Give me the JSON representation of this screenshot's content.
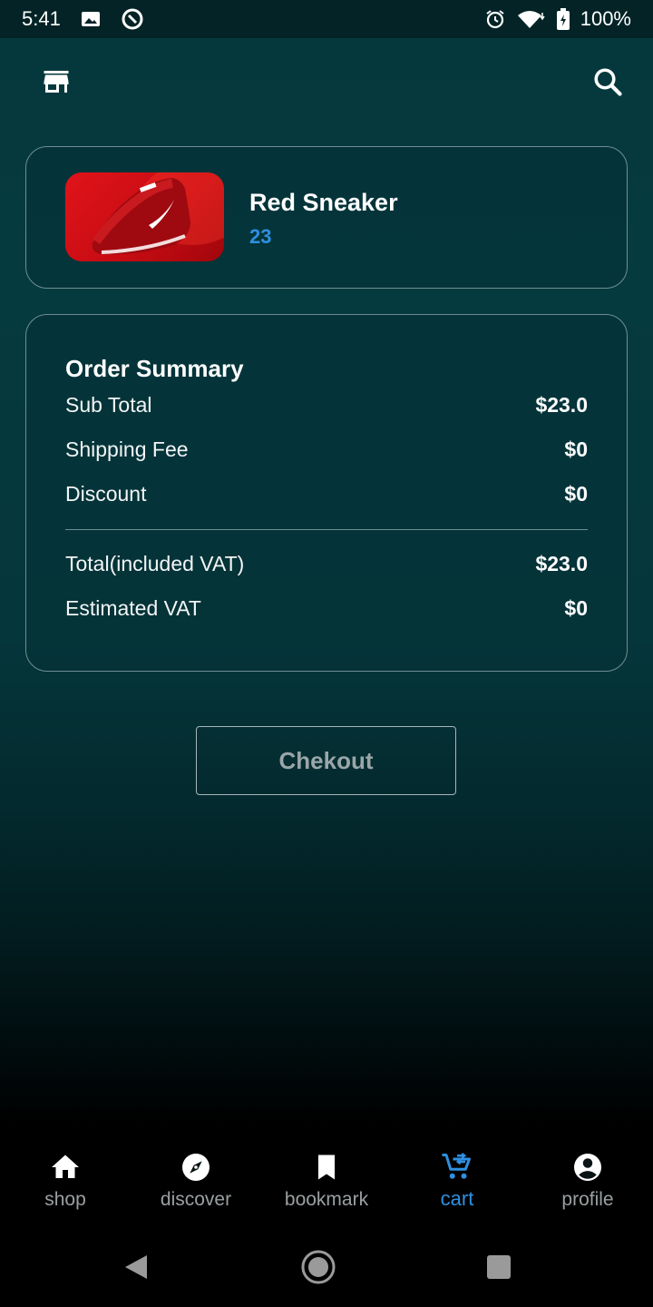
{
  "status_bar": {
    "time": "5:41",
    "battery": "100%",
    "icons_left": [
      "image-icon",
      "data-saver-icon"
    ],
    "icons_right": [
      "alarm-icon",
      "wifi-icon",
      "battery-icon"
    ]
  },
  "app_bar": {
    "left_icon": "store-icon",
    "right_icon": "search-icon"
  },
  "cart_item": {
    "name": "Red Sneaker",
    "quantity": "23",
    "image": "red-sneaker"
  },
  "order_summary": {
    "title": "Order Summary",
    "rows": [
      {
        "label": "Sub Total",
        "value": "$23.0"
      },
      {
        "label": "Shipping Fee",
        "value": "$0"
      },
      {
        "label": "Discount",
        "value": "$0"
      },
      {
        "label": "Total(included VAT)",
        "value": "$23.0"
      },
      {
        "label": "Estimated VAT",
        "value": "$0"
      }
    ]
  },
  "checkout_label": "Chekout",
  "bottom_nav": {
    "items": [
      {
        "label": "shop",
        "icon": "home-icon"
      },
      {
        "label": "discover",
        "icon": "compass-icon"
      },
      {
        "label": "bookmark",
        "icon": "bookmark-icon"
      },
      {
        "label": "cart",
        "icon": "cart-icon",
        "active": true
      },
      {
        "label": "profile",
        "icon": "profile-icon"
      }
    ]
  },
  "colors": {
    "accent": "#2f8fe0",
    "background_top": "#05383c",
    "card_border": "#6f8f92"
  }
}
